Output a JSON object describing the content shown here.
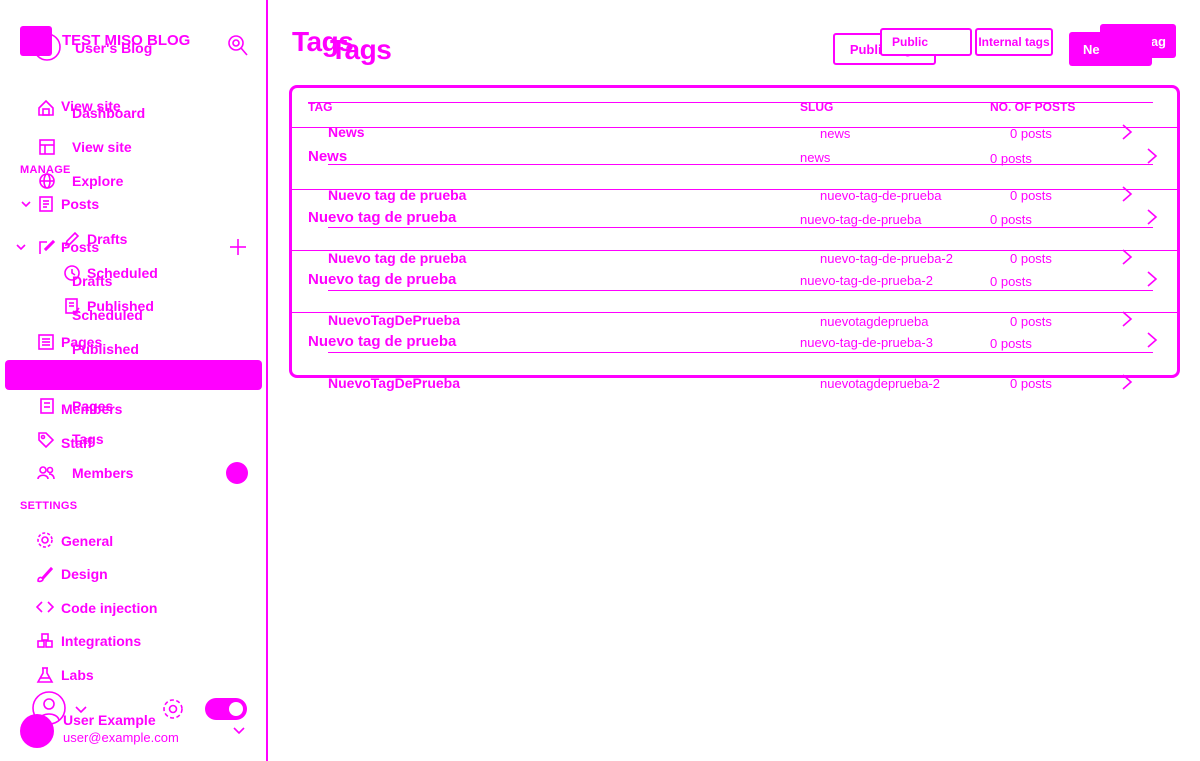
{
  "sidebar": {
    "blog_title": "TEST MISO BLOG",
    "blog_subtitle": "User's Blog",
    "nav_ghost": [
      "View site",
      "Dashboard"
    ],
    "nav": [
      {
        "label": "View site",
        "icon": "layout-icon"
      },
      {
        "label": "Explore",
        "icon": "globe-icon"
      }
    ],
    "manage_label": "MANAGE",
    "posts_label": "Posts",
    "posts_ghost_label": "Posts",
    "drafts_label": "Drafts",
    "scheduled_label": "Scheduled",
    "published_label": "Published",
    "drafts_ghost": "Drafts",
    "scheduled_ghost": "Scheduled",
    "published_ghost": "Published",
    "pages_ghost": "Pages",
    "pages_label": "Pages",
    "members_ghost": "Members",
    "tags_label": "Tags",
    "staff_label": "Staff",
    "members_label": "Members",
    "settings_label": "SETTINGS",
    "settings_items": [
      {
        "label": "General",
        "icon": "gear-icon"
      },
      {
        "label": "Design",
        "icon": "brush-icon"
      },
      {
        "label": "Code injection",
        "icon": "code-icon"
      },
      {
        "label": "Integrations",
        "icon": "puzzle-icon"
      },
      {
        "label": "Labs",
        "icon": "flask-icon"
      }
    ],
    "user_name": "User Example",
    "user_email": "user@example.com"
  },
  "header": {
    "title": "Tags",
    "title_ghost": "Tags",
    "public_tags_label": "Public tags",
    "public_label": "Public",
    "internal_tags_label": "Internal tags",
    "new_tag_label": "New tag",
    "new_tag_ghost": "Ne"
  },
  "table": {
    "columns": [
      "TAG",
      "SLUG",
      "NO. OF POSTS"
    ],
    "rows": [
      {
        "name": "News",
        "slug": "news",
        "count": "0 posts"
      },
      {
        "name": "Nuevo tag de prueba",
        "slug": "nuevo-tag-de-prueba",
        "count": "0 posts"
      },
      {
        "name": "Nuevo tag de prueba",
        "slug": "nuevo-tag-de-prueba-2",
        "count": "0 posts"
      },
      {
        "name": "Nuevo tag de prueba",
        "slug": "nuevo-tag-de-prueba-3",
        "count": "0 posts"
      }
    ],
    "ghost_rows": [
      {
        "name": "News",
        "slug": "news",
        "count": "0 posts"
      },
      {
        "name": "Nuevo tag de prueba",
        "slug": "nuevo-tag-de-prueba",
        "count": "0 posts"
      },
      {
        "name": "Nuevo tag de prueba",
        "slug": "nuevo-tag-de-prueba-2",
        "count": "0 posts"
      },
      {
        "name": "NuevoTagDePrueba",
        "slug": "nuevotagdeprueba",
        "count": "0 posts"
      },
      {
        "name": "NuevoTagDePrueba",
        "slug": "nuevotagdeprueba-2",
        "count": "0 posts"
      }
    ]
  },
  "colors": {
    "accent": "#ff00ff",
    "background": "#ffffff"
  }
}
